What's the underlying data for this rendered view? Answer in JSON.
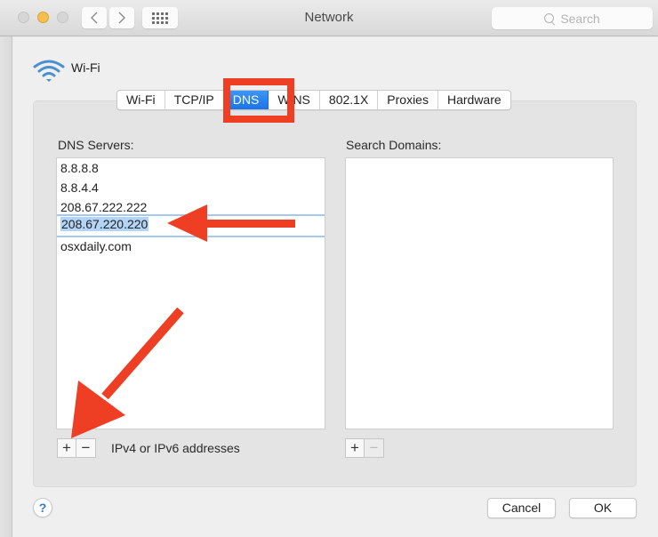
{
  "window": {
    "title": "Network",
    "search_placeholder": "Search",
    "traffic_lights": [
      "close",
      "minimize",
      "zoom"
    ],
    "nav": {
      "back_icon": "chevron-left-icon",
      "forward_icon": "chevron-right-icon",
      "grid_icon": "show-all-grid-icon"
    }
  },
  "interface": {
    "name": "Wi-Fi",
    "icon": "wifi-icon",
    "icon_color": "#4a8fd0"
  },
  "tabs": [
    {
      "label": "Wi-Fi",
      "active": false
    },
    {
      "label": "TCP/IP",
      "active": false
    },
    {
      "label": "DNS",
      "active": true
    },
    {
      "label": "WINS",
      "active": false
    },
    {
      "label": "802.1X",
      "active": false
    },
    {
      "label": "Proxies",
      "active": false
    },
    {
      "label": "Hardware",
      "active": false
    }
  ],
  "dns_servers": {
    "label": "DNS Servers:",
    "items": [
      "8.8.8.8",
      "8.8.4.4",
      "208.67.222.222",
      "208.67.220.220",
      "osxdaily.com"
    ],
    "editing_index": 3,
    "add_label": "+",
    "remove_label": "−",
    "hint": "IPv4 or IPv6 addresses"
  },
  "search_domains": {
    "label": "Search Domains:",
    "items": [],
    "add_label": "+",
    "remove_label": "−"
  },
  "footer": {
    "help_label": "?",
    "cancel_label": "Cancel",
    "ok_label": "OK"
  },
  "annotations": {
    "color": "#ee3f24",
    "highlight_target": "DNS tab",
    "arrows": [
      "pointing to 208.67.220.220",
      "pointing to add (+) button"
    ]
  }
}
